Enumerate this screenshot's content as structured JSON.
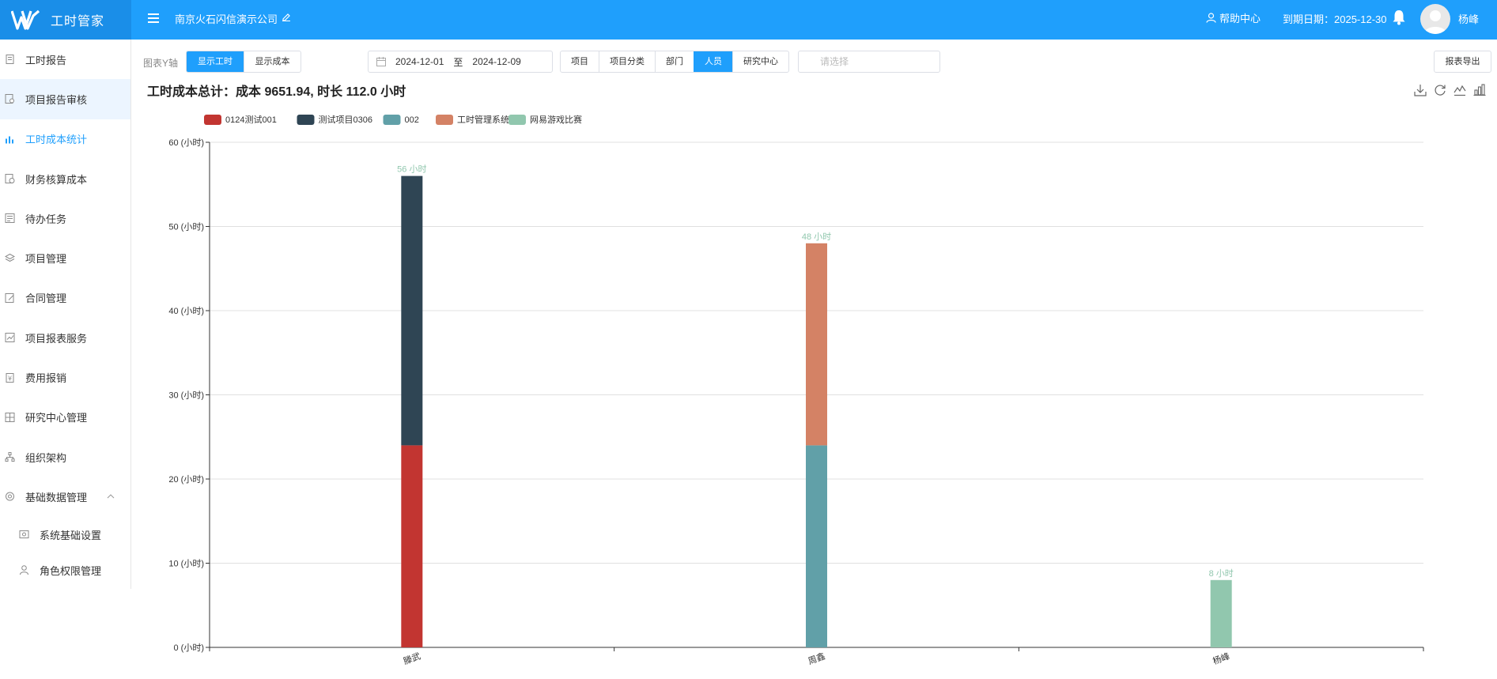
{
  "app": {
    "title": "工时管家"
  },
  "header": {
    "company": "南京火石闪信演示公司",
    "help": "帮助中心",
    "expire": "到期日期：2025-12-30",
    "username": "杨峰"
  },
  "sidebar": {
    "items": [
      {
        "label": "工时报告",
        "icon": "document-icon"
      },
      {
        "label": "项目报告审核",
        "icon": "audit-icon"
      },
      {
        "label": "工时成本统计",
        "icon": "bar-chart-icon"
      },
      {
        "label": "财务核算成本",
        "icon": "finance-icon"
      },
      {
        "label": "待办任务",
        "icon": "task-icon"
      },
      {
        "label": "项目管理",
        "icon": "layers-icon"
      },
      {
        "label": "合同管理",
        "icon": "contract-icon"
      },
      {
        "label": "项目报表服务",
        "icon": "report-icon"
      },
      {
        "label": "费用报销",
        "icon": "expense-icon"
      },
      {
        "label": "研究中心管理",
        "icon": "grid-icon"
      },
      {
        "label": "组织架构",
        "icon": "org-icon"
      },
      {
        "label": "基础数据管理",
        "icon": "database-icon"
      }
    ],
    "sub_items": [
      {
        "label": "系统基础设置",
        "icon": "settings-icon"
      },
      {
        "label": "角色权限管理",
        "icon": "user-icon"
      }
    ]
  },
  "toolbar": {
    "y_axis_label": "图表Y轴",
    "y_options": [
      "显示工时",
      "显示成本"
    ],
    "date_start": "2024-12-01",
    "date_sep": "至",
    "date_end": "2024-12-09",
    "dimensions": [
      "项目",
      "项目分类",
      "部门",
      "人员",
      "研究中心"
    ],
    "select_placeholder": "请选择",
    "export": "报表导出"
  },
  "summary": "工时成本总计：成本 9651.94, 时长 112.0 小时",
  "colors": {
    "accent": "#1f9ffc",
    "series": [
      "#c23531",
      "#2f4554",
      "#61a0a8",
      "#d48265",
      "#91c7ae"
    ]
  },
  "chart_data": {
    "type": "bar",
    "stacked": true,
    "categories": [
      "滕武",
      "周鑫",
      "杨峰"
    ],
    "series": [
      {
        "name": "0124测试001",
        "values": [
          24,
          0,
          0
        ]
      },
      {
        "name": "测试项目0306",
        "values": [
          32,
          0,
          0
        ]
      },
      {
        "name": "002",
        "values": [
          0,
          24,
          0
        ]
      },
      {
        "name": "工时管理系统",
        "values": [
          0,
          24,
          0
        ]
      },
      {
        "name": "网易游戏比赛",
        "values": [
          0,
          0,
          8
        ]
      }
    ],
    "totals": [
      "56 小时",
      "48 小时",
      "8 小时"
    ],
    "y_ticks": [
      "0 (小时)",
      "10 (小时)",
      "20 (小时)",
      "30 (小时)",
      "40 (小时)",
      "50 (小时)",
      "60 (小时)"
    ],
    "ylim": [
      0,
      60
    ],
    "grid": true,
    "legend_position": "top-left"
  }
}
